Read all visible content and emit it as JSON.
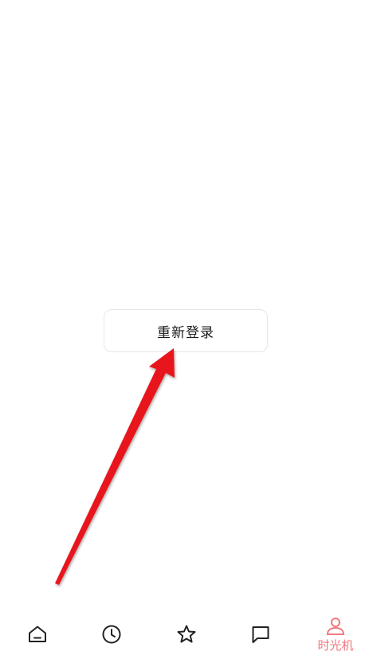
{
  "main": {
    "relogin_label": "重新登录"
  },
  "annotation": {
    "color": "#e8141b"
  },
  "bottom_nav": {
    "active_color": "#f0787f",
    "inactive_color": "#222222",
    "items": [
      {
        "icon": "home-icon",
        "label": ""
      },
      {
        "icon": "clock-icon",
        "label": ""
      },
      {
        "icon": "star-icon",
        "label": ""
      },
      {
        "icon": "message-icon",
        "label": ""
      },
      {
        "icon": "user-icon",
        "label": "时光机",
        "active": true
      }
    ]
  }
}
